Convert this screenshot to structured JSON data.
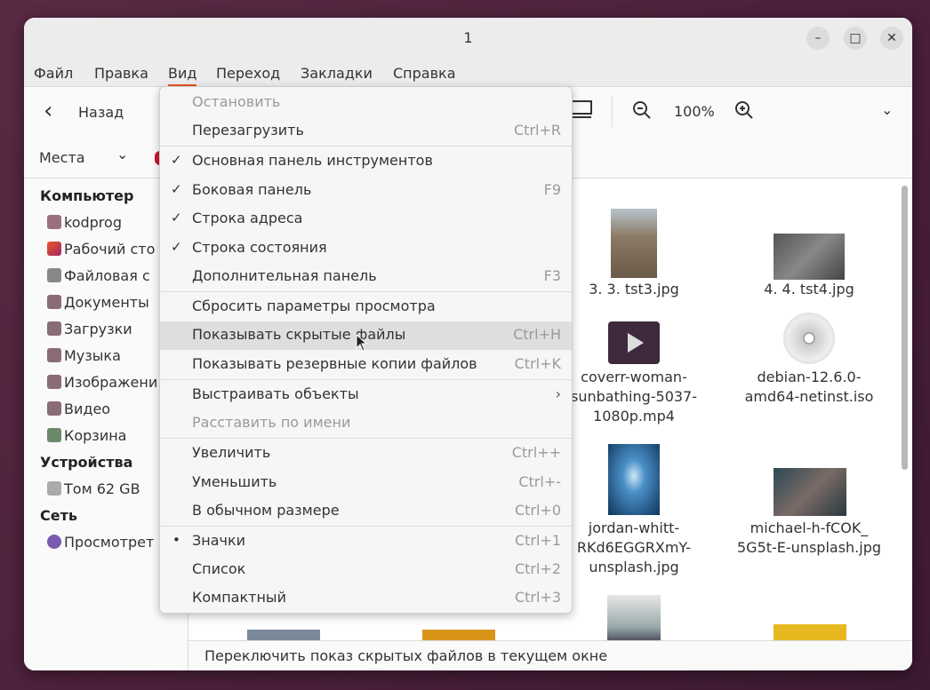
{
  "window": {
    "title": "1"
  },
  "menubar": [
    "Файл",
    "Правка",
    "Вид",
    "Переход",
    "Закладки",
    "Справка"
  ],
  "toolbar": {
    "back_label": "Назад",
    "zoom_level": "100%",
    "places_label": "Места"
  },
  "sidebar": {
    "computer_header": "Компьютер",
    "computer_items": [
      "kodprog",
      "Рабочий сто",
      "Файловая с",
      "Документы",
      "Загрузки",
      "Музыка",
      "Изображени",
      "Видео",
      "Корзина"
    ],
    "devices_header": "Устройства",
    "devices_items": [
      "Том 62 GB"
    ],
    "network_header": "Сеть",
    "network_items": [
      "Просмотрет"
    ]
  },
  "files": {
    "f1": "3. 3. tst3.jpg",
    "f2": "4. 4. tst4.jpg",
    "f3_1": "coverr-woman-",
    "f3_2": "sunbathing-5037-",
    "f3_3": "1080p.mp4",
    "f4_1": "debian-12.6.0-",
    "f4_2": "amd64-netinst.iso",
    "f5_1": "jordan-whitt-",
    "f5_2": "RKd6EGGRXmY-",
    "f5_3": "unsplash.jpg",
    "f6_1": "michael-h-fCOK_",
    "f6_2": "5G5t-E-unsplash.jpg"
  },
  "status": "Переключить показ скрытых файлов в текущем окне",
  "menu": {
    "items": [
      {
        "label": "Остановить",
        "shortcut": ""
      },
      {
        "label": "Перезагрузить",
        "shortcut": "Ctrl+R"
      },
      {
        "label": "Основная панель инструментов",
        "shortcut": ""
      },
      {
        "label": "Боковая панель",
        "shortcut": "F9"
      },
      {
        "label": "Строка адреса",
        "shortcut": ""
      },
      {
        "label": "Строка состояния",
        "shortcut": ""
      },
      {
        "label": "Дополнительная панель",
        "shortcut": "F3"
      },
      {
        "label": "Сбросить параметры просмотра",
        "shortcut": ""
      },
      {
        "label": "Показывать скрытые файлы",
        "shortcut": "Ctrl+H"
      },
      {
        "label": "Показывать резервные копии файлов",
        "shortcut": "Ctrl+K"
      },
      {
        "label": "Выстраивать объекты",
        "shortcut": "›"
      },
      {
        "label": "Расставить по имени",
        "shortcut": ""
      },
      {
        "label": "Увеличить",
        "shortcut": "Ctrl++"
      },
      {
        "label": "Уменьшить",
        "shortcut": "Ctrl+-"
      },
      {
        "label": "В обычном размере",
        "shortcut": "Ctrl+0"
      },
      {
        "label": "Значки",
        "shortcut": "Ctrl+1"
      },
      {
        "label": "Список",
        "shortcut": "Ctrl+2"
      },
      {
        "label": "Компактный",
        "shortcut": "Ctrl+3"
      }
    ],
    "check_mark": "✓",
    "radio_mark": "•"
  }
}
